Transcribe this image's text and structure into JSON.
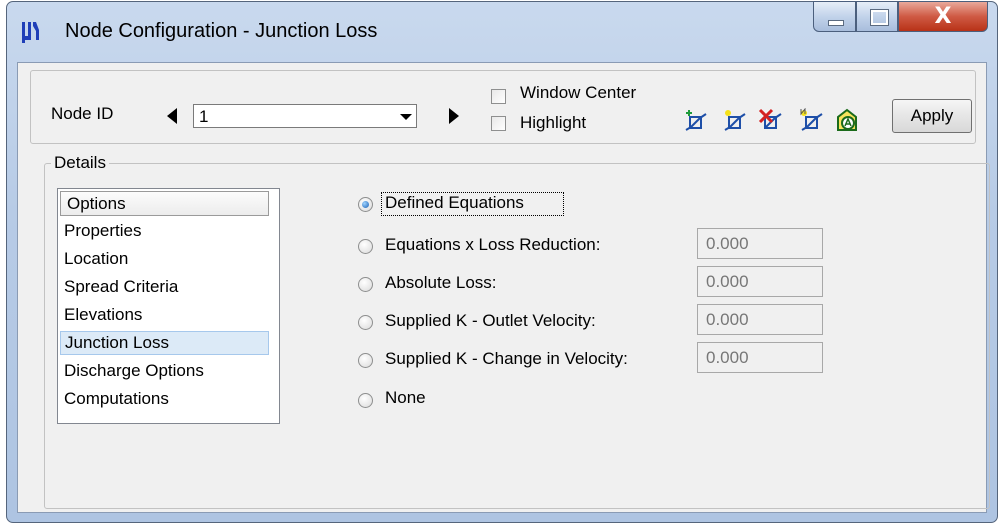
{
  "window": {
    "title": "Node Configuration - Junction Loss",
    "close_glyph": "X"
  },
  "toolbar": {
    "node_id_label": "Node ID",
    "node_id_value": "1",
    "window_center_label": "Window Center",
    "window_center_checked": false,
    "highlight_label": "Highlight",
    "highlight_checked": false,
    "apply_label": "Apply",
    "icons": [
      "add-node-icon",
      "place-node-icon",
      "delete-node-icon",
      "renumber-node-icon",
      "node-report-icon"
    ]
  },
  "details": {
    "group_label": "Details",
    "list_header": "Options",
    "items": [
      "Properties",
      "Location",
      "Spread Criteria",
      "Elevations",
      "Junction Loss",
      "Discharge Options",
      "Computations"
    ],
    "selected_item": "Junction Loss"
  },
  "junction_loss": {
    "options": [
      {
        "label": "Defined Equations",
        "checked": true
      },
      {
        "label": "Equations x Loss Reduction:",
        "value": "0.000",
        "checked": false
      },
      {
        "label": "Absolute Loss:",
        "value": "0.000",
        "checked": false
      },
      {
        "label": "Supplied K - Outlet Velocity:",
        "value": "0.000",
        "checked": false
      },
      {
        "label": "Supplied K - Change in Velocity:",
        "value": "0.000",
        "checked": false
      },
      {
        "label": "None",
        "checked": false
      }
    ]
  },
  "colors": {
    "title_gradient": "#b7cbe6",
    "close_button": "#cf5a44",
    "selection": "#dceaf7",
    "radio_checked": "#1a5fb4"
  }
}
